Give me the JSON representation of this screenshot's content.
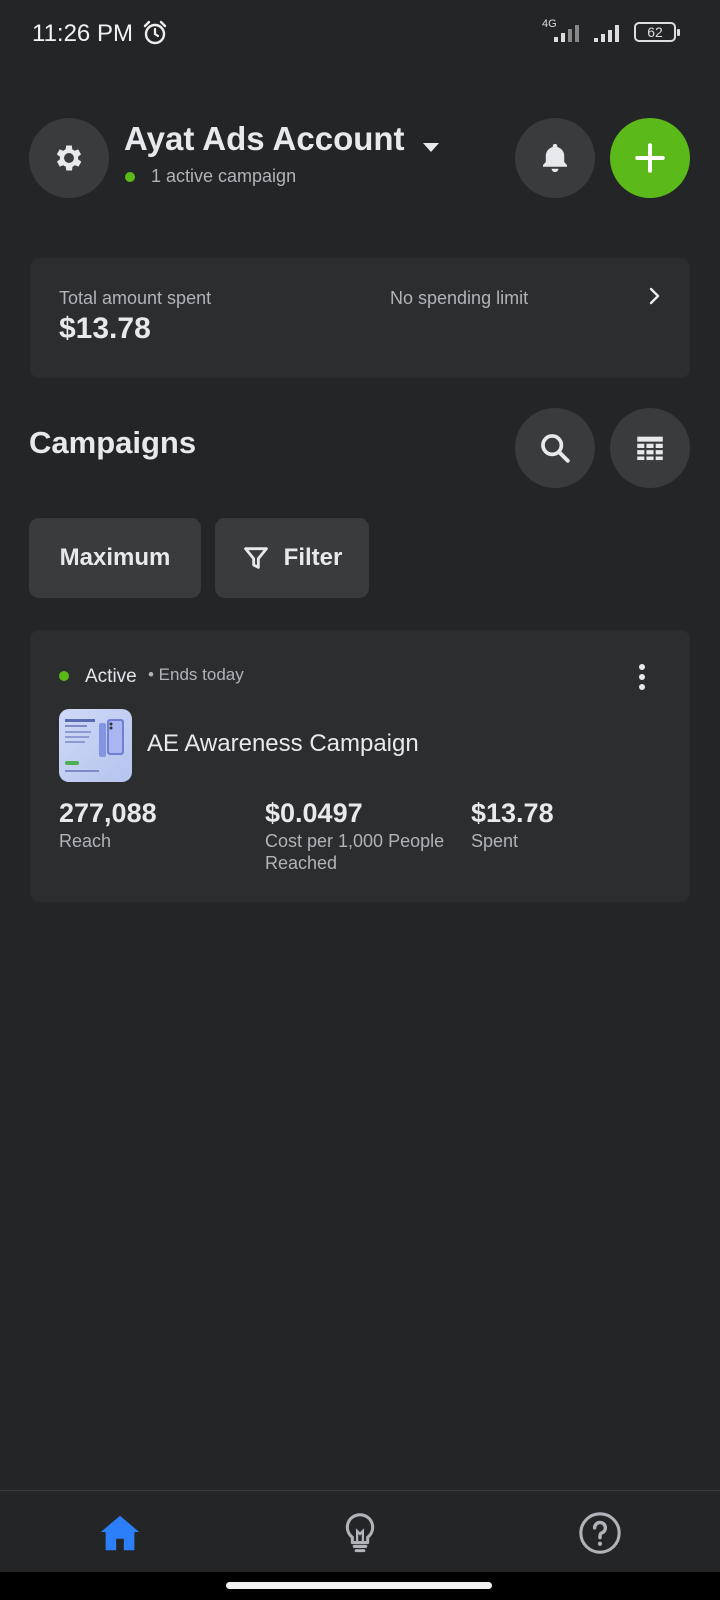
{
  "status_bar": {
    "time": "11:26 PM",
    "network": "4G",
    "battery": "62",
    "icons": [
      "alarm-icon",
      "signal-icon",
      "signal-icon",
      "battery-icon"
    ]
  },
  "header": {
    "account_name": "Ayat Ads Account",
    "subtitle": "1 active campaign",
    "icons": [
      "gear-icon",
      "caret-down-icon",
      "bell-icon",
      "plus-icon"
    ]
  },
  "spending": {
    "total_label": "Total amount spent",
    "total_value": "$13.78",
    "limit_label": "No spending limit"
  },
  "campaigns": {
    "title": "Campaigns",
    "sort_label": "Maximum",
    "filter_label": "Filter",
    "items": [
      {
        "status": "Active",
        "ends": "• Ends today",
        "name": "AE Awareness Campaign",
        "reach_value": "277,088",
        "reach_label": "Reach",
        "cpm_value": "$0.0497",
        "cpm_label_line1": "Cost per 1,000 People",
        "cpm_label_line2": "Reached",
        "spent_value": "$13.78",
        "spent_label": "Spent"
      }
    ]
  },
  "bottom_nav": {
    "items": [
      "home-icon",
      "lightbulb-icon",
      "help-icon"
    ],
    "active": "home"
  },
  "colors": {
    "background": "#242527",
    "card": "#2c2d2f",
    "accent_green": "#5cb91a",
    "accent_blue": "#2d7ff9"
  }
}
